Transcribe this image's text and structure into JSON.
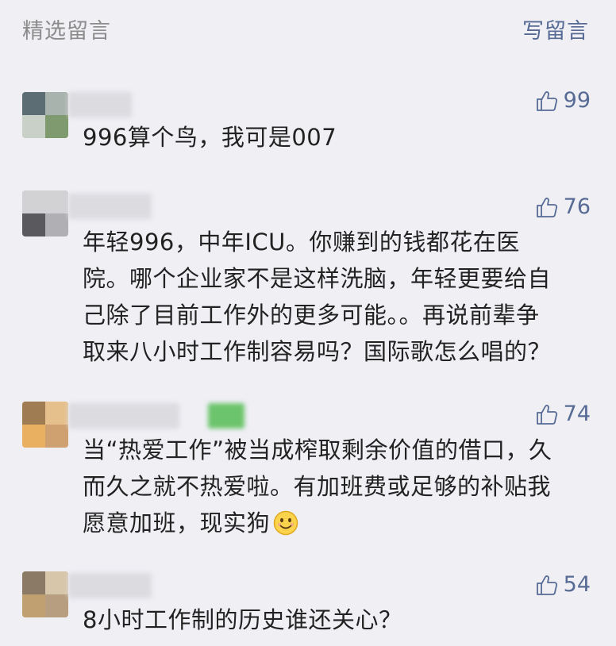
{
  "header": {
    "title": "精选留言",
    "write_label": "写留言"
  },
  "comments": [
    {
      "likes": "99",
      "lines": [
        "996算个鸟，我可是007"
      ]
    },
    {
      "likes": "76",
      "lines": [
        "年轻996，中年ICU。你赚到的钱都花在医",
        "院。哪个企业家不是这样洗脑，年轻更要给自",
        "己除了目前工作外的更多可能。。再说前辈争",
        "取来八小时工作制容易吗？国际歌怎么唱的？"
      ]
    },
    {
      "likes": "74",
      "lines": [
        "当“热爱工作”被当成榨取剩余价值的借口，久",
        "而久之就不热爱啦。有加班费或足够的补贴我",
        "愿意加班，现实狗"
      ],
      "trailing_icon": "smile-emoji-icon"
    },
    {
      "likes": "54",
      "lines": [
        "8小时工作制的历史谁还关心？"
      ]
    }
  ],
  "colors": {
    "background": "#efeff4",
    "link": "#576b95",
    "muted": "#8c8c8c",
    "text": "#222222"
  },
  "icons": {
    "like": "thumbs-up-icon"
  }
}
